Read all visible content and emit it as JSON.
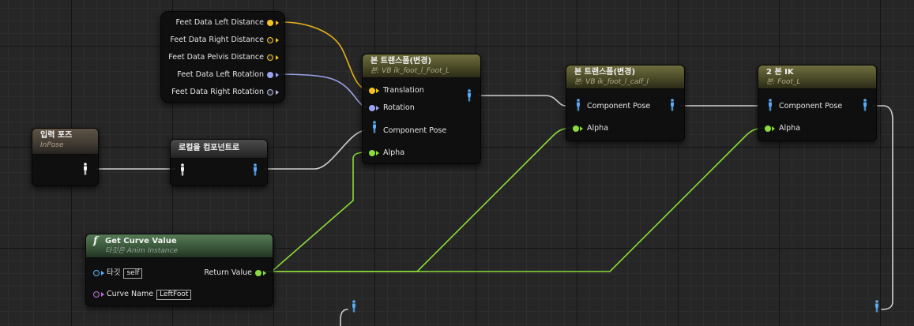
{
  "nodes": {
    "feet_data": {
      "pins": [
        "Feet Data Left Distance",
        "Feet Data Right Distance",
        "Feet Data Pelvis Distance",
        "Feet Data Left Rotation",
        "Feet Data Right Rotation"
      ]
    },
    "input_pose": {
      "title": "입력 포즈",
      "subtitle": "InPose"
    },
    "local_to_component": {
      "title": "로컬을 컴포넌트로"
    },
    "transform_bone_1": {
      "title": "본 트랜스폼(변경)",
      "subtitle": "본: VB ik_foot_l_Foot_L",
      "pins": {
        "translation": "Translation",
        "rotation": "Rotation",
        "component_pose": "Component Pose",
        "alpha": "Alpha"
      }
    },
    "transform_bone_2": {
      "title": "본 트랜스폼(변경)",
      "subtitle": "본: VB ik_foot_l_calf_l",
      "pins": {
        "component_pose": "Component Pose",
        "alpha": "Alpha"
      }
    },
    "two_bone_ik": {
      "title": "2 본 IK",
      "subtitle": "본: Foot_L",
      "pins": {
        "component_pose": "Component Pose",
        "alpha": "Alpha"
      }
    },
    "get_curve_value": {
      "function_icon": "f",
      "title": "Get Curve Value",
      "subtitle": "타깃은 Anim Instance",
      "pins": {
        "target": "타깃",
        "target_value": "self",
        "curve_name": "Curve Name",
        "curve_name_value": "LeftFoot",
        "return_value": "Return Value"
      }
    }
  },
  "colors": {
    "vector_pin": "#f5c21d",
    "rotator_pin": "#9aa3f0",
    "float_pin": "#8bdc3a",
    "pose_pin": "#5aa9f2",
    "exec_wire": "#c8c8c8",
    "object_pin": "#4fb4ff",
    "name_pin": "#b46cd8"
  },
  "icons": [
    "pose-figure-icon",
    "function-icon",
    "pin-arrow-icon"
  ]
}
